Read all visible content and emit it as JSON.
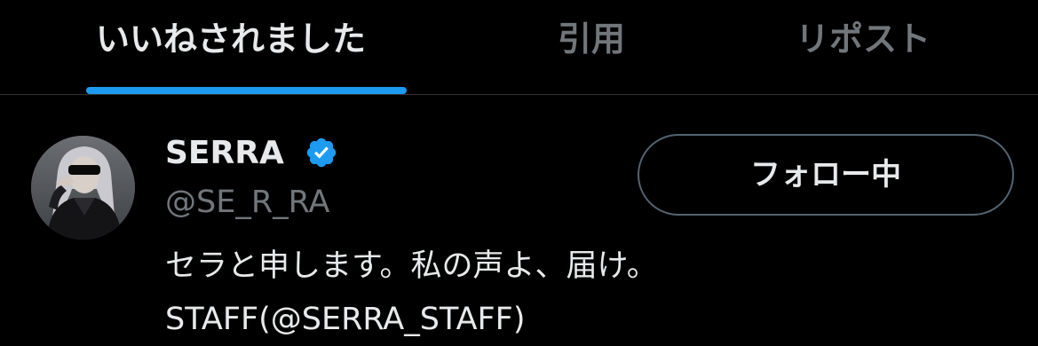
{
  "tabs": [
    {
      "label": "いいねされました",
      "active": true
    },
    {
      "label": "引用",
      "active": false
    },
    {
      "label": "リポスト",
      "active": false
    }
  ],
  "user": {
    "display_name": "SERRA",
    "verified": true,
    "handle": "@SE_R_RA",
    "bio_lines": [
      "セラと申します。私の声よ、届け。",
      "STAFF(@SERRA_STAFF)"
    ],
    "follow_button_label": "フォロー中",
    "avatar_icon": "user-avatar-photo",
    "verified_icon": "verified-badge-icon"
  },
  "colors": {
    "background": "#000000",
    "primary_text": "#e7e9ea",
    "secondary_text": "#71767b",
    "accent": "#1d9bf0",
    "divider": "#2f3336",
    "button_border": "#536471"
  }
}
